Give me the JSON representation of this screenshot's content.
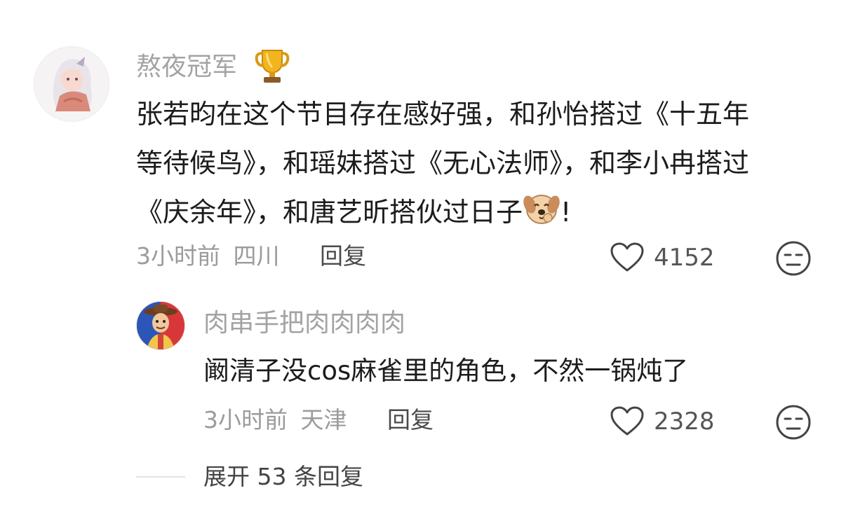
{
  "comment": {
    "username": "熬夜冠军",
    "badge_icon": "trophy-icon",
    "text_line1": "张若昀在这个节目存在感好强，和孙怡搭过《十五年",
    "text_line2": "等待候鸟》，和瑶妹搭过《无心法师》，和李小冉搭过",
    "text_line3": "《庆余年》，和唐艺昕搭伙过日子",
    "text_end": "!",
    "inline_emoji": "puppy-face-emoji",
    "time": "3小时前",
    "location": "四川",
    "reply_label": "回复",
    "like_count": "4152"
  },
  "reply": {
    "username": "肉串手把肉肉肉肉",
    "text": "阚清子没cos麻雀里的角色，不然一锅炖了",
    "time": "3小时前",
    "location": "天津",
    "reply_label": "回复",
    "like_count": "2328"
  },
  "expand": {
    "label": "展开 53 条回复"
  },
  "colors": {
    "name": "#a3a3a3",
    "meta": "#9b9b9b",
    "text": "#1c1c1c"
  }
}
